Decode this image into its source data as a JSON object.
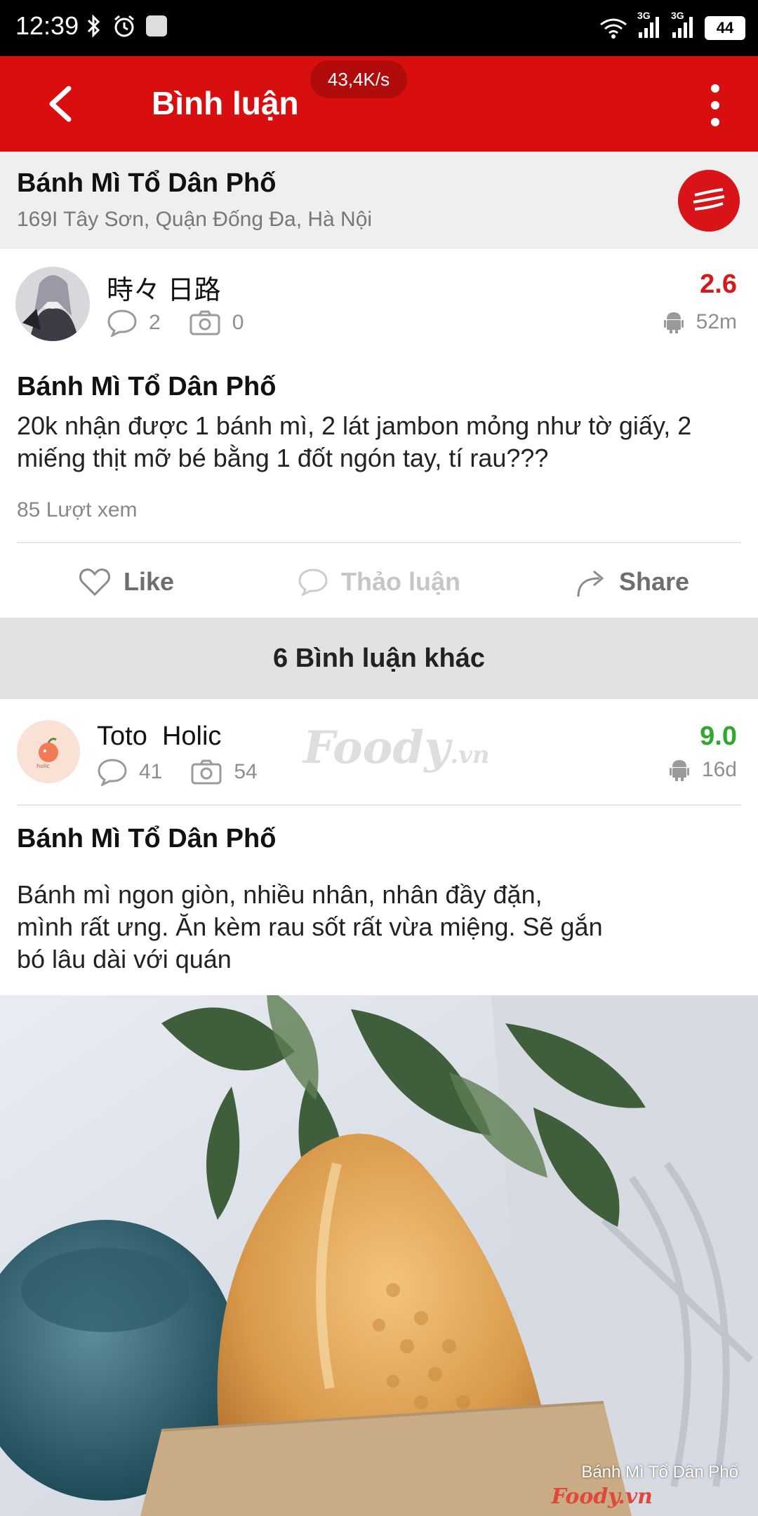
{
  "status_bar": {
    "time": "12:39",
    "network_label_1": "3G",
    "network_label_2": "3G",
    "battery": "44",
    "left_icons": [
      "bluetooth-icon",
      "alarm-icon",
      "notification-square-icon"
    ],
    "right_icons": [
      "wifi-icon",
      "signal-icon",
      "signal-icon",
      "battery-icon"
    ]
  },
  "app_bar": {
    "title": "Bình luận",
    "speed": "43,4K/s",
    "color": "#d90f0f"
  },
  "restaurant": {
    "name": "Bánh Mì Tổ Dân Phố",
    "address": "169I Tây Sơn, Quận Đống Đa, Hà Nội"
  },
  "main_review": {
    "user": "時々 日路",
    "comments": "2",
    "photos": "0",
    "score": "2.6",
    "score_color": "#d61a1a",
    "time_ago": "52m",
    "title": "Bánh Mì Tổ Dân Phố",
    "body": "20k nhận được 1 bánh mì, 2 lát jambon mỏng như tờ giấy, 2 miếng thịt mỡ bé bằng 1 đốt ngón tay, tí rau???",
    "views": "85 Lượt xem"
  },
  "actions": {
    "like": "Like",
    "discuss": "Thảo luận",
    "share": "Share"
  },
  "more_comments": "6 Bình luận khác",
  "second_review": {
    "user": "Toto  Holic",
    "comments": "41",
    "photos": "54",
    "score": "9.0",
    "score_color": "#2ea82e",
    "time_ago": "16d",
    "title": "Bánh Mì Tổ Dân Phố",
    "body_line1": "Bánh mì ngon giòn, nhiều nhân, nhân đầy đặn,",
    "body_line2": "mình rất ưng. Ăn kèm rau sốt rất vừa miệng. Sẽ gắn",
    "body_line3": "bó lâu dài với quán",
    "photo_caption": "Bánh Mì Tổ Dân Phố",
    "photo_brand": "Foody.vn"
  },
  "watermark": {
    "brand": "Foody",
    "suffix": ".vn"
  }
}
